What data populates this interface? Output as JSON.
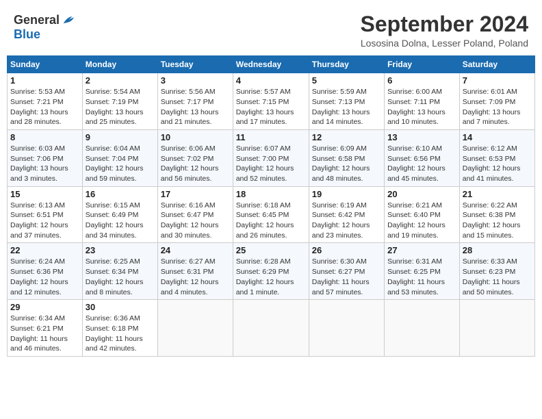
{
  "header": {
    "logo_general": "General",
    "logo_blue": "Blue",
    "month_title": "September 2024",
    "location": "Lososina Dolna, Lesser Poland, Poland"
  },
  "days_of_week": [
    "Sunday",
    "Monday",
    "Tuesday",
    "Wednesday",
    "Thursday",
    "Friday",
    "Saturday"
  ],
  "weeks": [
    [
      {
        "day": "1",
        "info": "Sunrise: 5:53 AM\nSunset: 7:21 PM\nDaylight: 13 hours\nand 28 minutes."
      },
      {
        "day": "2",
        "info": "Sunrise: 5:54 AM\nSunset: 7:19 PM\nDaylight: 13 hours\nand 25 minutes."
      },
      {
        "day": "3",
        "info": "Sunrise: 5:56 AM\nSunset: 7:17 PM\nDaylight: 13 hours\nand 21 minutes."
      },
      {
        "day": "4",
        "info": "Sunrise: 5:57 AM\nSunset: 7:15 PM\nDaylight: 13 hours\nand 17 minutes."
      },
      {
        "day": "5",
        "info": "Sunrise: 5:59 AM\nSunset: 7:13 PM\nDaylight: 13 hours\nand 14 minutes."
      },
      {
        "day": "6",
        "info": "Sunrise: 6:00 AM\nSunset: 7:11 PM\nDaylight: 13 hours\nand 10 minutes."
      },
      {
        "day": "7",
        "info": "Sunrise: 6:01 AM\nSunset: 7:09 PM\nDaylight: 13 hours\nand 7 minutes."
      }
    ],
    [
      {
        "day": "8",
        "info": "Sunrise: 6:03 AM\nSunset: 7:06 PM\nDaylight: 13 hours\nand 3 minutes."
      },
      {
        "day": "9",
        "info": "Sunrise: 6:04 AM\nSunset: 7:04 PM\nDaylight: 12 hours\nand 59 minutes."
      },
      {
        "day": "10",
        "info": "Sunrise: 6:06 AM\nSunset: 7:02 PM\nDaylight: 12 hours\nand 56 minutes."
      },
      {
        "day": "11",
        "info": "Sunrise: 6:07 AM\nSunset: 7:00 PM\nDaylight: 12 hours\nand 52 minutes."
      },
      {
        "day": "12",
        "info": "Sunrise: 6:09 AM\nSunset: 6:58 PM\nDaylight: 12 hours\nand 48 minutes."
      },
      {
        "day": "13",
        "info": "Sunrise: 6:10 AM\nSunset: 6:56 PM\nDaylight: 12 hours\nand 45 minutes."
      },
      {
        "day": "14",
        "info": "Sunrise: 6:12 AM\nSunset: 6:53 PM\nDaylight: 12 hours\nand 41 minutes."
      }
    ],
    [
      {
        "day": "15",
        "info": "Sunrise: 6:13 AM\nSunset: 6:51 PM\nDaylight: 12 hours\nand 37 minutes."
      },
      {
        "day": "16",
        "info": "Sunrise: 6:15 AM\nSunset: 6:49 PM\nDaylight: 12 hours\nand 34 minutes."
      },
      {
        "day": "17",
        "info": "Sunrise: 6:16 AM\nSunset: 6:47 PM\nDaylight: 12 hours\nand 30 minutes."
      },
      {
        "day": "18",
        "info": "Sunrise: 6:18 AM\nSunset: 6:45 PM\nDaylight: 12 hours\nand 26 minutes."
      },
      {
        "day": "19",
        "info": "Sunrise: 6:19 AM\nSunset: 6:42 PM\nDaylight: 12 hours\nand 23 minutes."
      },
      {
        "day": "20",
        "info": "Sunrise: 6:21 AM\nSunset: 6:40 PM\nDaylight: 12 hours\nand 19 minutes."
      },
      {
        "day": "21",
        "info": "Sunrise: 6:22 AM\nSunset: 6:38 PM\nDaylight: 12 hours\nand 15 minutes."
      }
    ],
    [
      {
        "day": "22",
        "info": "Sunrise: 6:24 AM\nSunset: 6:36 PM\nDaylight: 12 hours\nand 12 minutes."
      },
      {
        "day": "23",
        "info": "Sunrise: 6:25 AM\nSunset: 6:34 PM\nDaylight: 12 hours\nand 8 minutes."
      },
      {
        "day": "24",
        "info": "Sunrise: 6:27 AM\nSunset: 6:31 PM\nDaylight: 12 hours\nand 4 minutes."
      },
      {
        "day": "25",
        "info": "Sunrise: 6:28 AM\nSunset: 6:29 PM\nDaylight: 12 hours\nand 1 minute."
      },
      {
        "day": "26",
        "info": "Sunrise: 6:30 AM\nSunset: 6:27 PM\nDaylight: 11 hours\nand 57 minutes."
      },
      {
        "day": "27",
        "info": "Sunrise: 6:31 AM\nSunset: 6:25 PM\nDaylight: 11 hours\nand 53 minutes."
      },
      {
        "day": "28",
        "info": "Sunrise: 6:33 AM\nSunset: 6:23 PM\nDaylight: 11 hours\nand 50 minutes."
      }
    ],
    [
      {
        "day": "29",
        "info": "Sunrise: 6:34 AM\nSunset: 6:21 PM\nDaylight: 11 hours\nand 46 minutes."
      },
      {
        "day": "30",
        "info": "Sunrise: 6:36 AM\nSunset: 6:18 PM\nDaylight: 11 hours\nand 42 minutes."
      },
      {
        "day": "",
        "info": ""
      },
      {
        "day": "",
        "info": ""
      },
      {
        "day": "",
        "info": ""
      },
      {
        "day": "",
        "info": ""
      },
      {
        "day": "",
        "info": ""
      }
    ]
  ]
}
